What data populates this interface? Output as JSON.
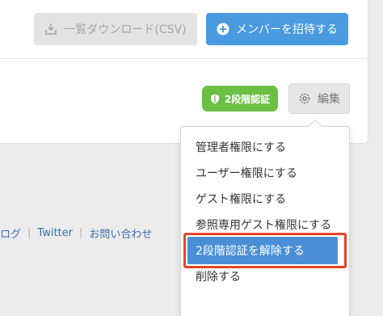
{
  "toolbar": {
    "download_label": "一覧ダウンロード(CSV)",
    "download_icon": "download-icon",
    "invite_label": "メンバーを招待する",
    "invite_icon": "plus-circle-icon"
  },
  "member_row": {
    "badge_label": "2段階認証",
    "badge_icon": "shield-icon",
    "edit_label": "編集",
    "edit_icon": "gear-icon"
  },
  "dropdown": {
    "items": [
      {
        "label": "管理者権限にする"
      },
      {
        "label": "ユーザー権限にする"
      },
      {
        "label": "ゲスト権限にする"
      },
      {
        "label": "参照専用ゲスト権限にする"
      },
      {
        "label": "2段階認証を解除する"
      },
      {
        "label": "削除する"
      }
    ]
  },
  "footer": {
    "links": [
      "ログ",
      "Twitter",
      "お問い合わせ"
    ]
  },
  "colors": {
    "primary": "#4a9ae0",
    "success": "#6cbf45",
    "highlight_frame": "#e8432b",
    "link": "#3c6fb0"
  }
}
